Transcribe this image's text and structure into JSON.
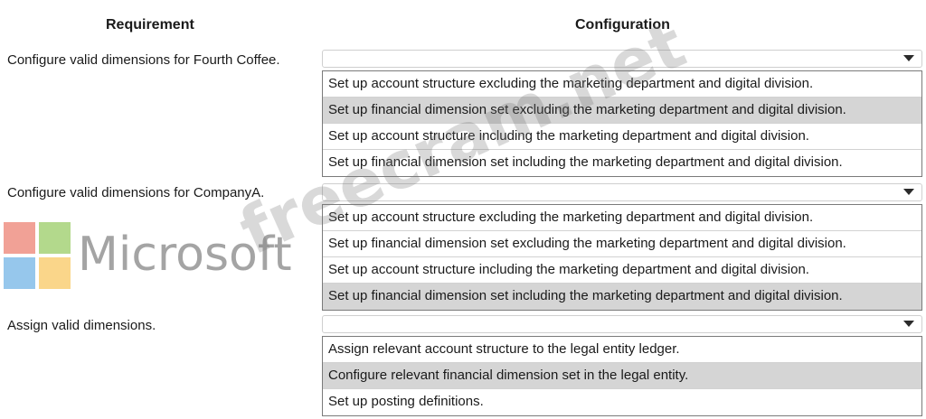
{
  "headers": {
    "requirement": "Requirement",
    "configuration": "Configuration"
  },
  "rows": [
    {
      "requirement": "Configure valid dimensions for Fourth Coffee.",
      "options": [
        "Set up account structure excluding the marketing department and digital division.",
        "Set up financial dimension set excluding the marketing department and digital division.",
        "Set up account structure including the marketing department and digital division.",
        "Set up financial dimension set including the marketing department and digital division."
      ],
      "selected_index": 1
    },
    {
      "requirement": "Configure valid dimensions for CompanyA.",
      "options": [
        "Set up account structure excluding the marketing department and digital division.",
        "Set up financial dimension set excluding the marketing department and digital division.",
        "Set up account structure including the marketing department and digital division.",
        "Set up financial dimension set including the marketing department and digital division."
      ],
      "selected_index": 3
    },
    {
      "requirement": "Assign valid dimensions.",
      "options": [
        "Assign relevant account structure to the legal entity ledger.",
        "Configure relevant financial dimension set in the legal entity.",
        "Set up posting definitions."
      ],
      "selected_index": 1
    }
  ],
  "overlay": {
    "logo_text": "Microsoft",
    "watermark": "freecram.net"
  }
}
